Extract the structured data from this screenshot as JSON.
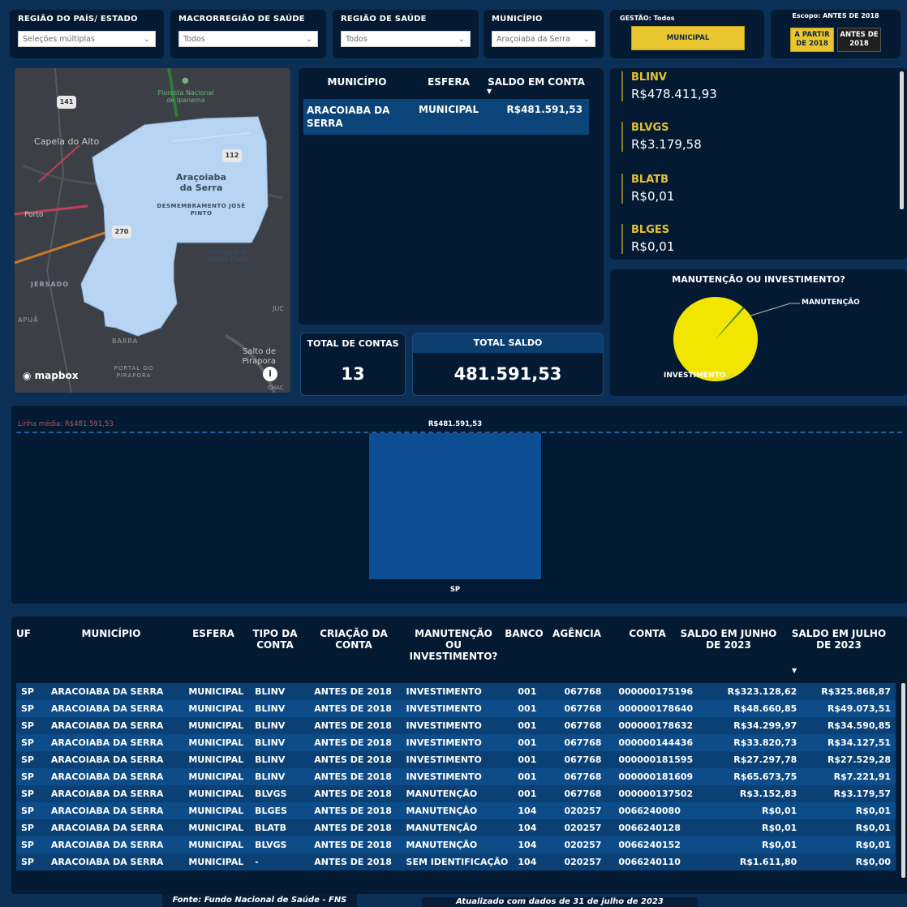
{
  "filters": [
    {
      "label": "REGIÃO DO PAÍS/ ESTADO",
      "value": "Seleções múltiplas"
    },
    {
      "label": "MACRORREGIÃO DE SAÚDE",
      "value": "Todos"
    },
    {
      "label": "REGIÃO DE SAÚDE",
      "value": "Todos"
    },
    {
      "label": "MUNICÍPIO",
      "value": "Araçoiaba da Serra"
    }
  ],
  "gestao": {
    "label": "GESTÃO: Todos",
    "button": "MUNICIPAL"
  },
  "escopo": {
    "label": "Escopo: ANTES DE 2018",
    "btn_a": "A PARTIR DE 2018",
    "btn_b": "ANTES DE 2018"
  },
  "map": {
    "labels": [
      "Floresta Nacional de Ipanema",
      "Capela do Alto",
      "Araçoiaba da Serra",
      "DESMEMBRAMENTO JOSÉ PINTO",
      "Villaggio di Santa Clara",
      "Porto",
      "JERSADO",
      "APUÃ",
      "BARRA",
      "Salto de Pirapora",
      "PORTAL DO PIRAPORA",
      "JUC",
      "CHAC"
    ],
    "shields": [
      "141",
      "112",
      "270"
    ],
    "attribution": "mapbox"
  },
  "muni_table": {
    "headers": [
      "MUNICÍPIO",
      "ESFERA",
      "SALDO EM CONTA"
    ],
    "row": [
      "ARACOIABA DA SERRA",
      "MUNICIPAL",
      "R$481.591,53"
    ]
  },
  "kpis": {
    "total_contas_label": "TOTAL DE CONTAS",
    "total_contas_value": "13",
    "total_saldo_label": "TOTAL SALDO",
    "total_saldo_value": "481.591,53"
  },
  "cards": [
    {
      "label": "BLINV",
      "value": "R$478.411,93"
    },
    {
      "label": "BLVGS",
      "value": "R$3.179,58"
    },
    {
      "label": "BLATB",
      "value": "R$0,01"
    },
    {
      "label": "BLGES",
      "value": "R$0,01"
    }
  ],
  "pie": {
    "title": "MANUTENÇÃO OU INVESTIMENTO?",
    "slices": [
      {
        "label": "MANUTENÇÃO",
        "value": 3179.59,
        "color": "#1f8a3a"
      },
      {
        "label": "INVESTIMENTO",
        "value": 478411.94,
        "color": "#f2e500"
      }
    ]
  },
  "chart_data": [
    {
      "type": "pie",
      "title": "MANUTENÇÃO OU INVESTIMENTO?",
      "categories": [
        "MANUTENÇÃO",
        "INVESTIMENTO"
      ],
      "values": [
        3179.59,
        478411.94
      ]
    },
    {
      "type": "bar",
      "categories": [
        "SP"
      ],
      "values": [
        481591.53
      ],
      "data_labels": [
        "R$481.591,53"
      ],
      "reference_line": {
        "label": "Linha média: R$481.591,53",
        "value": 481591.53
      },
      "ylim": [
        0,
        481591.53
      ]
    }
  ],
  "data_table": {
    "headers": [
      "UF",
      "MUNICÍPIO",
      "ESFERA",
      "TIPO DA CONTA",
      "CRIAÇÃO DA CONTA",
      "MANUTENÇÃO OU INVESTIMENTO?",
      "BANCO",
      "AGÊNCIA",
      "CONTA",
      "SALDO EM JUNHO DE 2023",
      "SALDO EM JULHO DE 2023"
    ],
    "rows": [
      [
        "SP",
        "ARACOIABA DA SERRA",
        "MUNICIPAL",
        "BLINV",
        "ANTES DE 2018",
        "INVESTIMENTO",
        "001",
        "067768",
        "000000175196",
        "R$323.128,62",
        "R$325.868,87"
      ],
      [
        "SP",
        "ARACOIABA DA SERRA",
        "MUNICIPAL",
        "BLINV",
        "ANTES DE 2018",
        "INVESTIMENTO",
        "001",
        "067768",
        "000000178640",
        "R$48.660,85",
        "R$49.073,51"
      ],
      [
        "SP",
        "ARACOIABA DA SERRA",
        "MUNICIPAL",
        "BLINV",
        "ANTES DE 2018",
        "INVESTIMENTO",
        "001",
        "067768",
        "000000178632",
        "R$34.299,97",
        "R$34.590,85"
      ],
      [
        "SP",
        "ARACOIABA DA SERRA",
        "MUNICIPAL",
        "BLINV",
        "ANTES DE 2018",
        "INVESTIMENTO",
        "001",
        "067768",
        "000000144436",
        "R$33.820,73",
        "R$34.127,51"
      ],
      [
        "SP",
        "ARACOIABA DA SERRA",
        "MUNICIPAL",
        "BLINV",
        "ANTES DE 2018",
        "INVESTIMENTO",
        "001",
        "067768",
        "000000181595",
        "R$27.297,78",
        "R$27.529,28"
      ],
      [
        "SP",
        "ARACOIABA DA SERRA",
        "MUNICIPAL",
        "BLINV",
        "ANTES DE 2018",
        "INVESTIMENTO",
        "001",
        "067768",
        "000000181609",
        "R$65.673,75",
        "R$7.221,91"
      ],
      [
        "SP",
        "ARACOIABA DA SERRA",
        "MUNICIPAL",
        "BLVGS",
        "ANTES DE 2018",
        "MANUTENÇÃO",
        "001",
        "067768",
        "000000137502",
        "R$3.152,83",
        "R$3.179,57"
      ],
      [
        "SP",
        "ARACOIABA DA SERRA",
        "MUNICIPAL",
        "BLGES",
        "ANTES DE 2018",
        "MANUTENÇÃO",
        "104",
        "020257",
        "0066240080",
        "R$0,01",
        "R$0,01"
      ],
      [
        "SP",
        "ARACOIABA DA SERRA",
        "MUNICIPAL",
        "BLATB",
        "ANTES DE 2018",
        "MANUTENÇÃO",
        "104",
        "020257",
        "0066240128",
        "R$0,01",
        "R$0,01"
      ],
      [
        "SP",
        "ARACOIABA DA SERRA",
        "MUNICIPAL",
        "BLVGS",
        "ANTES DE 2018",
        "MANUTENÇÃO",
        "104",
        "020257",
        "0066240152",
        "R$0,01",
        "R$0,01"
      ],
      [
        "SP",
        "ARACOIABA DA SERRA",
        "MUNICIPAL",
        "-",
        "ANTES DE 2018",
        "SEM IDENTIFICAÇÃO",
        "104",
        "020257",
        "0066240110",
        "R$1.611,80",
        "R$0,00"
      ]
    ]
  },
  "footer": {
    "source": "Fonte: Fundo Nacional de Saúde - FNS",
    "updated": "Atualizado com dados de 31 de julho de 2023"
  }
}
